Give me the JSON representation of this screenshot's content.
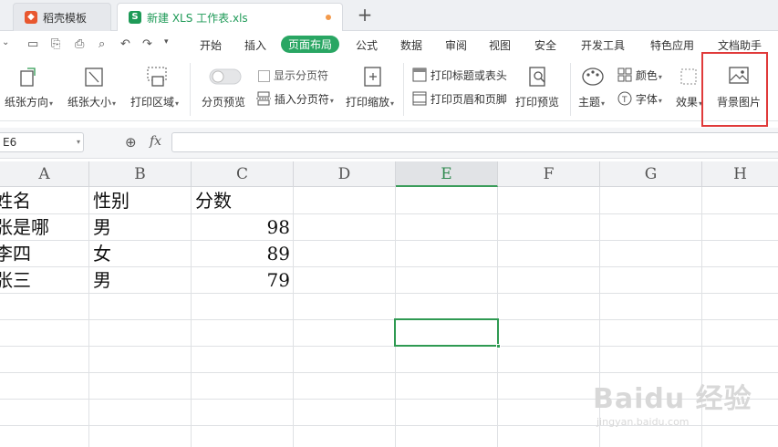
{
  "tabs": [
    {
      "label": "稻壳模板",
      "icon": "docer-icon",
      "color": "#e8572f"
    },
    {
      "label": "新建 XLS 工作表.xls",
      "icon": "sheet-icon",
      "color": "#1e9a57",
      "active": true
    }
  ],
  "menu": [
    "开始",
    "插入",
    "页面布局",
    "公式",
    "数据",
    "审阅",
    "视图",
    "安全",
    "开发工具",
    "特色应用",
    "文档助手"
  ],
  "menu_active": "页面布局",
  "ribbon": {
    "orientation": "纸张方向",
    "size": "纸张大小",
    "print_area": "打印区域",
    "page_break_preview": "分页预览",
    "show_page_breaks": "显示分页符",
    "insert_page_break": "插入分页符",
    "print_scale": "打印缩放",
    "print_titles": "打印标题或表头",
    "print_header_footer": "打印页眉和页脚",
    "print_preview": "打印预览",
    "theme": "主题",
    "colors": "颜色",
    "fonts": "字体",
    "effects": "效果",
    "background": "背景图片"
  },
  "formula_bar": {
    "cell_ref": "E6",
    "fx": "fx",
    "value": ""
  },
  "columns": [
    "A",
    "B",
    "C",
    "D",
    "E",
    "F",
    "G",
    "H"
  ],
  "selected_column": "E",
  "rows": [
    [
      "姓名",
      "性别",
      "分数"
    ],
    [
      "张是哪",
      "男",
      "98"
    ],
    [
      "李四",
      "女",
      "89"
    ],
    [
      "张三",
      "男",
      "79"
    ]
  ],
  "watermark": {
    "line1": "Baidu 经验",
    "line2": "jingyan.baidu.com"
  },
  "colors": {
    "accent": "#29a663",
    "highlight_border": "#e03a3a"
  }
}
